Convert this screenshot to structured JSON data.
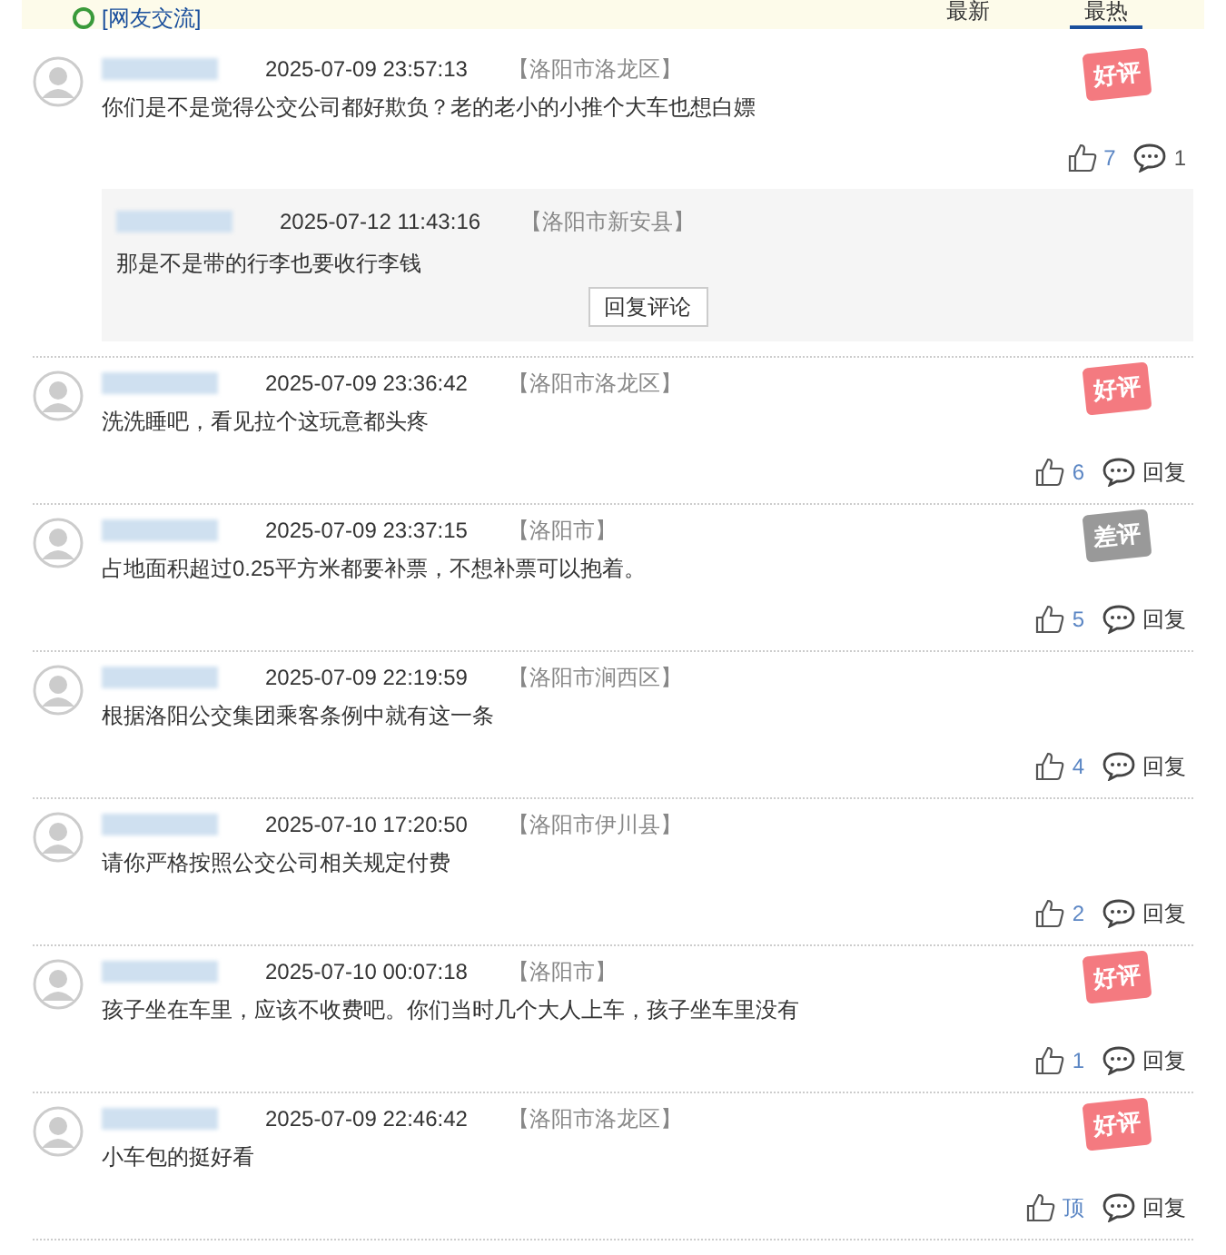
{
  "header": {
    "title": "[网友交流]",
    "tabs": [
      {
        "label": "最新",
        "selected": false
      },
      {
        "label": "最热",
        "selected": true
      }
    ]
  },
  "comments": [
    {
      "time": "2025-07-09 23:57:13",
      "location": "【洛阳市洛龙区】",
      "text": "你们是不是觉得公交公司都好欺负？老的老小的小推个大车也想白嫖",
      "badge": {
        "kind": "good",
        "label": "好评"
      },
      "likes": "7",
      "reply": {
        "kind": "count",
        "label": "1"
      },
      "replies": [
        {
          "time": "2025-07-12 11:43:16",
          "location": "【洛阳市新安县】",
          "text": "那是不是带的行李也要收行李钱"
        }
      ],
      "reply_button": "回复评论"
    },
    {
      "time": "2025-07-09 23:36:42",
      "location": "【洛阳市洛龙区】",
      "text": "洗洗睡吧，看见拉个这玩意都头疼",
      "badge": {
        "kind": "good",
        "label": "好评"
      },
      "likes": "6",
      "reply": {
        "kind": "text",
        "label": "回复"
      }
    },
    {
      "time": "2025-07-09 23:37:15",
      "location": "【洛阳市】",
      "text": "占地面积超过0.25平方米都要补票，不想补票可以抱着。",
      "badge": {
        "kind": "bad",
        "label": "差评"
      },
      "likes": "5",
      "reply": {
        "kind": "text",
        "label": "回复"
      }
    },
    {
      "time": "2025-07-09 22:19:59",
      "location": "【洛阳市涧西区】",
      "text": "根据洛阳公交集团乘客条例中就有这一条",
      "likes": "4",
      "reply": {
        "kind": "text",
        "label": "回复"
      }
    },
    {
      "time": "2025-07-10 17:20:50",
      "location": "【洛阳市伊川县】",
      "text": "请你严格按照公交公司相关规定付费",
      "likes": "2",
      "reply": {
        "kind": "text",
        "label": "回复"
      }
    },
    {
      "time": "2025-07-10 00:07:18",
      "location": "【洛阳市】",
      "text": "孩子坐在车里，应该不收费吧。你们当时几个大人上车，孩子坐车里没有",
      "badge": {
        "kind": "good",
        "label": "好评"
      },
      "likes": "1",
      "reply": {
        "kind": "text",
        "label": "回复"
      }
    },
    {
      "time": "2025-07-09 22:46:42",
      "location": "【洛阳市洛龙区】",
      "text": "小车包的挺好看",
      "badge": {
        "kind": "good",
        "label": "好评"
      },
      "likes": "顶",
      "reply": {
        "kind": "text",
        "label": "回复"
      }
    }
  ]
}
